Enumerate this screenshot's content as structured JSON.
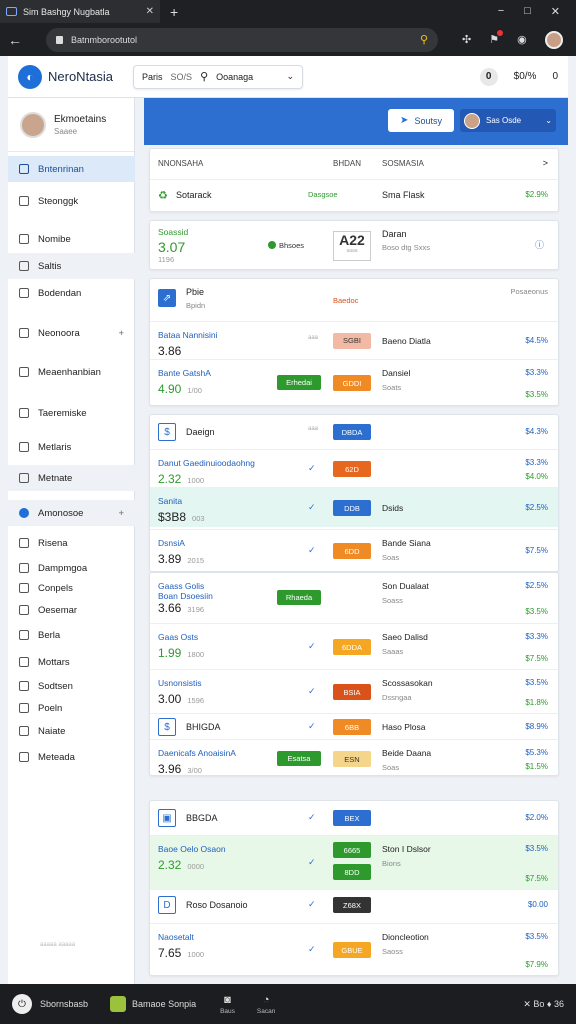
{
  "browser": {
    "tab_title": "Sim Bashgy Nugbatla",
    "url": "Batnmborootutol",
    "controls": [
      "−",
      "□",
      "✕"
    ]
  },
  "header": {
    "brand": "NeroNtasia",
    "search_left": "Paris",
    "search_mid": "SO/S",
    "search_value": "Ooanaga",
    "icon_badge": "0",
    "icon_text": "$0/%",
    "icon_ring": "0"
  },
  "sidebar": {
    "profile_name": "Ekmoetains",
    "profile_sub": "Saaee",
    "items": [
      {
        "label": "Bntenrinan",
        "state": "active",
        "plus": ""
      },
      {
        "label": "Steonggk",
        "state": "",
        "plus": ""
      },
      {
        "label": "Nomibe",
        "state": "",
        "plus": ""
      },
      {
        "label": "Saltis",
        "state": "shade",
        "plus": ""
      },
      {
        "label": "Bodendan",
        "state": "",
        "plus": ""
      },
      {
        "label": "Neonoora",
        "state": "",
        "plus": "+"
      },
      {
        "label": "Meaenhanbian",
        "state": "",
        "plus": ""
      },
      {
        "label": "Taeremiske",
        "state": "",
        "plus": ""
      },
      {
        "label": "Metlaris",
        "state": "",
        "plus": ""
      },
      {
        "label": "Metnate",
        "state": "shade",
        "plus": ""
      },
      {
        "label": "Amonosoe",
        "state": "shade",
        "plus": "+"
      },
      {
        "label": "Risena",
        "state": "",
        "plus": ""
      },
      {
        "label": "Dampmgoa",
        "state": "",
        "plus": ""
      },
      {
        "label": "Conpels",
        "state": "",
        "plus": ""
      },
      {
        "label": "Oesemar",
        "state": "",
        "plus": ""
      },
      {
        "label": "Berla",
        "state": "",
        "plus": ""
      },
      {
        "label": "Mottars",
        "state": "",
        "plus": ""
      },
      {
        "label": "Sodtsen",
        "state": "",
        "plus": ""
      },
      {
        "label": "Poeln",
        "state": "",
        "plus": ""
      },
      {
        "label": "Naiate",
        "state": "",
        "plus": ""
      },
      {
        "label": "Meteada",
        "state": "",
        "plus": ""
      }
    ],
    "footer": "aaaaa aaaaa"
  },
  "banner": {
    "button_label": "Soutsy",
    "user_label": "Sas Osde"
  },
  "table": {
    "col1": "NNONSAHA",
    "col2": "BHDAN",
    "col3": "SOSMASIA",
    "col_end": ">"
  },
  "summary": {
    "label": "Sotarack",
    "mid": "Dasgsoe",
    "desc": "Sma Flask",
    "value": "$2.9%"
  },
  "stat": {
    "label": "Soassid",
    "value": "3.07",
    "sub": "1196",
    "pill": "Bhsoes",
    "code": "A22",
    "code_sub": "aaaa",
    "title": "Daran",
    "title_sub": "Boso dtg Sxxs"
  },
  "group1": {
    "title": "Pbie",
    "sub": "Bpidn",
    "mid": "Baedoc",
    "right": "Posaeonus"
  },
  "rows": [
    {
      "l1": "Bataa Nannisini",
      "l2": "3.86",
      "l2sub": "",
      "tag": "SGBI",
      "tag_color": "#f2b9a4",
      "desc": "Baeno Diatla",
      "desc_sub": "",
      "v1": "$4.5%",
      "v2": "",
      "check": "aaa"
    },
    {
      "l1": "Bante GatshA",
      "l2": "4.90",
      "l2sub": "1/00",
      "tag": "GDDI",
      "tag_color": "#f08a24",
      "desc": "Dansiel",
      "desc_sub": "Soats",
      "v1": "$3.3%",
      "v2": "$3.5%",
      "check": "",
      "green": "Erhedai"
    },
    {
      "l1": "Daeign",
      "l2": "",
      "l2sub": "",
      "tag": "DBDA",
      "tag_color": "#2c6fd1",
      "desc": "",
      "desc_sub": "",
      "v1": "$4.3%",
      "v2": "",
      "check": "aaa",
      "icon": "$"
    },
    {
      "l1": "Danut Gaedinuioodaohng",
      "l2": "2.32",
      "l2sub": "1000",
      "tag": "62D",
      "tag_color": "#e8671f",
      "desc": "",
      "desc_sub": "",
      "v1": "$3.3%",
      "v2": "$4.0%",
      "check": "✓"
    },
    {
      "l1": "Sanita",
      "l2": "$3B8",
      "l2sub": "003",
      "tag": "DDB",
      "tag_color": "#2c6fd1",
      "desc": "Dsids",
      "desc_sub": "",
      "v1": "$2.5%",
      "v2": "",
      "check": "✓"
    },
    {
      "l1": "DsnsiA",
      "l2": "3.89",
      "l2sub": "2015",
      "tag": "6DD",
      "tag_color": "#f08a24",
      "desc": "Bande Siana",
      "desc_sub": "Soas",
      "v1": "$7.5%",
      "v2": "",
      "check": "✓"
    },
    {
      "l1": "Gaass Golis",
      "l1b": "Boan Dsoesiin",
      "l2": "3.66",
      "l2sub": "3196",
      "tag": "",
      "tag_color": "",
      "desc": "Son Dualaat",
      "desc_sub": "Soass",
      "v1": "$2.5%",
      "v2": "$3.5%",
      "check": "",
      "green": "Rhaeda"
    },
    {
      "l1": "Gaas Osts",
      "l2": "1.99",
      "l2sub": "1800",
      "tag": "6DDA",
      "tag_color": "#f5a623",
      "desc": "Saeo Dalisd",
      "desc_sub": "Saaas",
      "v1": "$3.3%",
      "v2": "$7.5%",
      "check": "✓"
    },
    {
      "l1": "Usnonsistis",
      "l2": "3.00",
      "l2sub": "1596",
      "tag": "BSIA",
      "tag_color": "#d8521a",
      "desc": "Scossasokan",
      "desc_sub": "Dssngaa",
      "v1": "$3.5%",
      "v2": "$1.8%",
      "check": "✓"
    },
    {
      "l1": "BHIGDA",
      "l2": "",
      "l2sub": "",
      "tag": "6BB",
      "tag_color": "#f08a24",
      "desc": "Haso Plosa",
      "desc_sub": "",
      "v1": "$8.9%",
      "v2": "",
      "check": "✓",
      "icon": "$"
    },
    {
      "l1": "Daenicafs AnoaisinA",
      "l2": "3.96",
      "l2sub": "3/00",
      "tag": "ESN",
      "tag_color": "#f5d58a",
      "desc": "Beide Daana",
      "desc_sub": "Soas",
      "v1": "$5.3%",
      "v2": "$1.5%",
      "check": "",
      "green": "Esatsa"
    },
    {
      "l1": "BBGDA",
      "l2": "",
      "l2sub": "",
      "tag": "BEX",
      "tag_color": "#2c6fd1",
      "desc": "",
      "desc_sub": "",
      "v1": "$2.0%",
      "v2": "",
      "check": "✓",
      "icon": "▣"
    },
    {
      "l1": "Baoe Oelo Osaon",
      "l2": "2.32",
      "l2sub": "0000",
      "tag": "6665",
      "tag_color": "#2e9a2e",
      "tag2": "8DD",
      "desc": "Ston I Dslsor",
      "desc_sub": "Bions",
      "v1": "$3.5%",
      "v2": "$7.5%",
      "check": "✓"
    },
    {
      "l1": "Roso Dosanoio",
      "l2": "",
      "l2sub": "",
      "tag": "Z68X",
      "tag_color": "#333",
      "desc": "",
      "desc_sub": "",
      "v1": "$0.00",
      "v2": "",
      "check": "✓",
      "icon": "D"
    },
    {
      "l1": "Naosetalt",
      "l2": "7.65",
      "l2sub": "1000",
      "tag": "GBUE",
      "tag_color": "#f5a623",
      "desc": "Dioncleotion",
      "desc_sub": "Saoss",
      "v1": "$3.5%",
      "v2": "$7.9%",
      "check": "✓"
    }
  ],
  "taskbar": {
    "user": "Sbornsbasb",
    "app": "Bamaoe Sonpia",
    "ic1": "Baus",
    "ic2": "Sacan",
    "right": "✕ Bo ♦ 36"
  }
}
